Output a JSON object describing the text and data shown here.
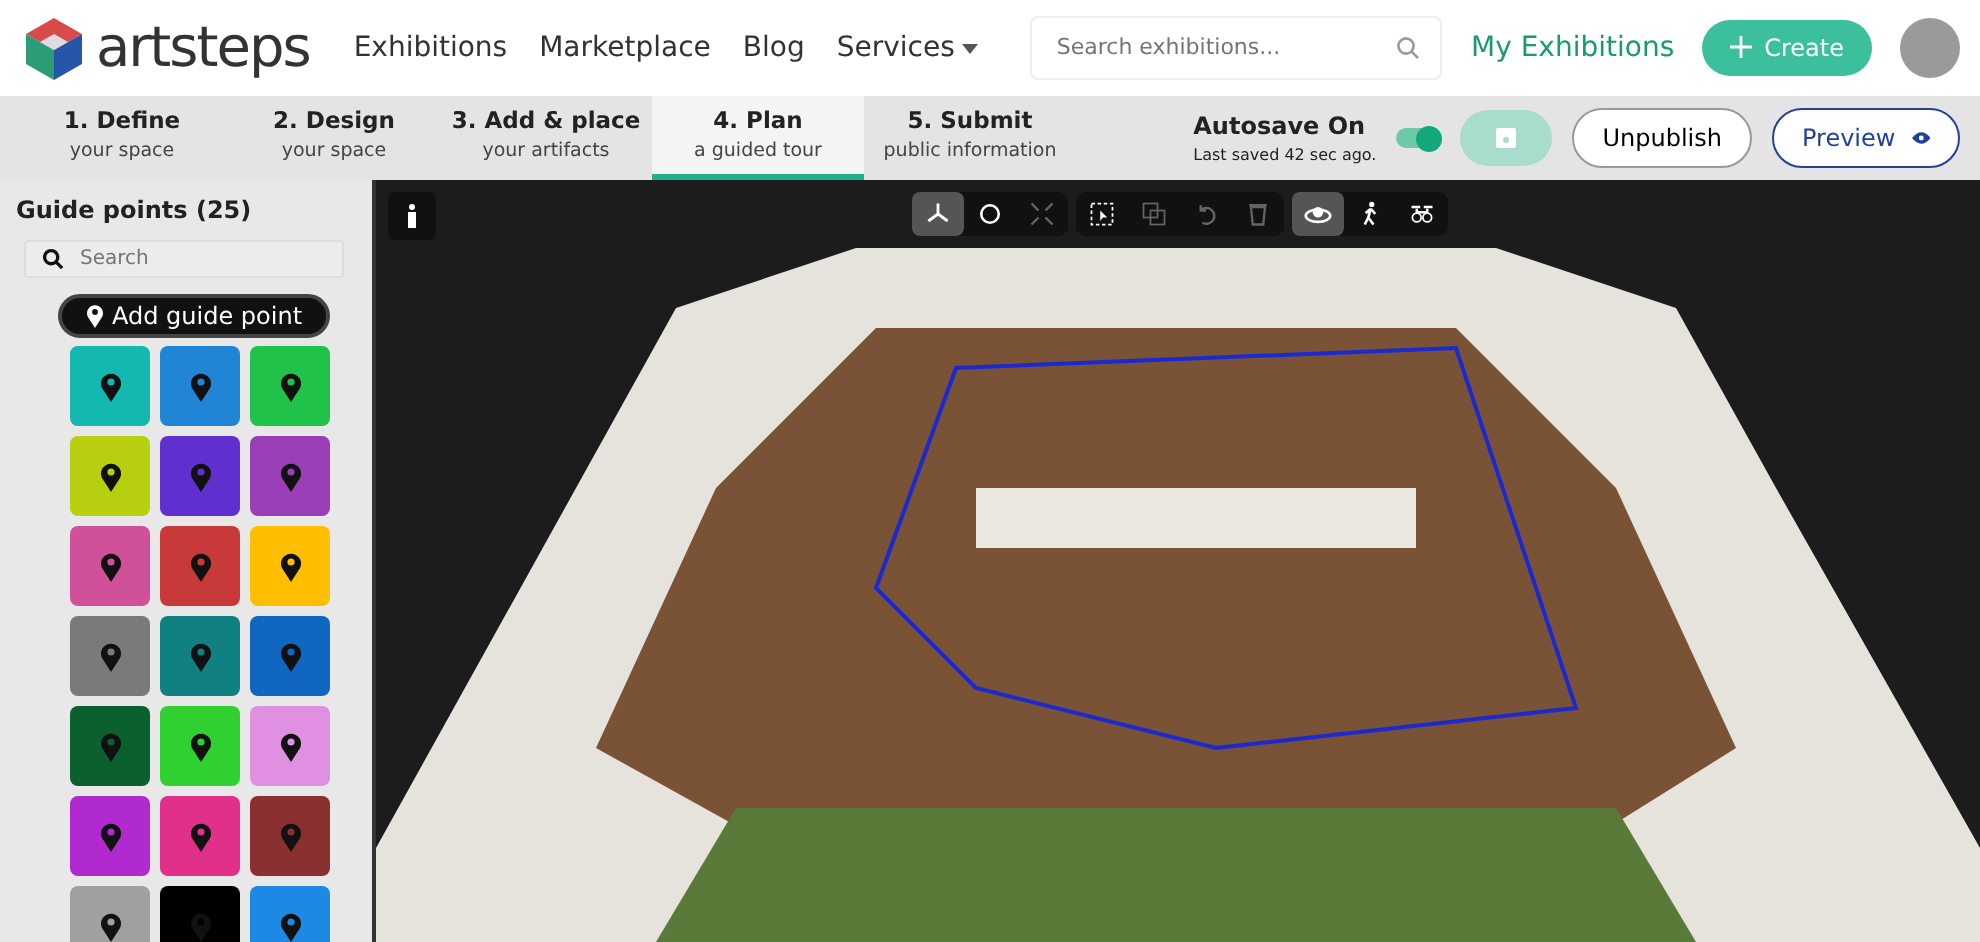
{
  "navbar": {
    "brand": "artsteps",
    "links": [
      "Exhibitions",
      "Marketplace",
      "Blog"
    ],
    "dropdown": "Services",
    "search": {
      "placeholder": "Search exhibitions..."
    },
    "my_exhibitions": "My Exhibitions",
    "create": "Create"
  },
  "steps": [
    {
      "title": "1. Define",
      "subtitle": "your space",
      "selected": false
    },
    {
      "title": "2. Design",
      "subtitle": "your space",
      "selected": false
    },
    {
      "title": "3. Add & place",
      "subtitle": "your artifacts",
      "selected": false
    },
    {
      "title": "4. Plan",
      "subtitle": "a guided tour",
      "selected": true
    },
    {
      "title": "5. Submit",
      "subtitle": "public information",
      "selected": false
    }
  ],
  "autosave": {
    "label": "Autosave On",
    "status": "Last saved 42 sec ago.",
    "on": true
  },
  "actions": {
    "unpublish": "Unpublish",
    "preview": "Preview"
  },
  "sidebar": {
    "title": "Guide points (25)",
    "search": {
      "placeholder": "Search"
    },
    "add_button": "Add guide point",
    "swatches": [
      {
        "color": "#14b8b0"
      },
      {
        "color": "#2185d5"
      },
      {
        "color": "#21c24a"
      },
      {
        "color": "#b8cf10"
      },
      {
        "color": "#5f2fd0"
      },
      {
        "color": "#9a3fb8"
      },
      {
        "color": "#d0509a"
      },
      {
        "color": "#c83a3a"
      },
      {
        "color": "#ffbf00"
      },
      {
        "color": "#7a7a7a"
      },
      {
        "color": "#108080"
      },
      {
        "color": "#1166c0"
      },
      {
        "color": "#0b6030"
      },
      {
        "color": "#30d030"
      },
      {
        "color": "#e090e0"
      },
      {
        "color": "#b02ad0"
      },
      {
        "color": "#e0308a"
      },
      {
        "color": "#8a3030"
      },
      {
        "color": "#a0a0a0"
      },
      {
        "color": "#000000"
      },
      {
        "color": "#1e88e5"
      }
    ]
  },
  "toolbar": [
    [
      {
        "kind": "move",
        "selected": true,
        "disabled": false
      },
      {
        "kind": "rotate",
        "selected": false,
        "disabled": false
      },
      {
        "kind": "scale",
        "selected": false,
        "disabled": true
      }
    ],
    [
      {
        "kind": "select",
        "selected": false,
        "disabled": false
      },
      {
        "kind": "copy",
        "selected": false,
        "disabled": true
      },
      {
        "kind": "undo",
        "selected": false,
        "disabled": true
      },
      {
        "kind": "delete",
        "selected": false,
        "disabled": true
      }
    ],
    [
      {
        "kind": "orbit",
        "selected": true,
        "disabled": false
      },
      {
        "kind": "walk",
        "selected": false,
        "disabled": false
      },
      {
        "kind": "drone",
        "selected": false,
        "disabled": false
      }
    ]
  ]
}
